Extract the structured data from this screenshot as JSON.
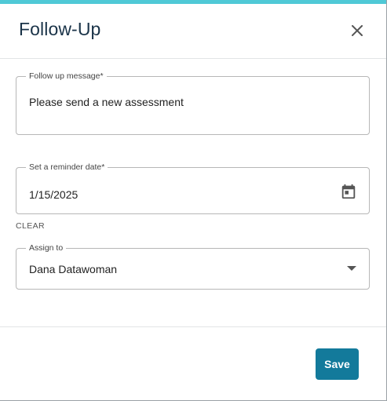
{
  "dialog": {
    "title": "Follow-Up",
    "close_icon": "close-icon"
  },
  "form": {
    "message": {
      "label": "Follow up message*",
      "value": "Please send a new assessment"
    },
    "reminder_date": {
      "label": "Set a reminder date*",
      "value": "1/15/2025",
      "icon": "calendar-icon",
      "clear_label": "CLEAR"
    },
    "assign_to": {
      "label": "Assign to",
      "value": "Dana Datawoman",
      "icon": "chevron-down-icon"
    }
  },
  "footer": {
    "save_label": "Save"
  },
  "colors": {
    "accent_bar": "#4fc9d6",
    "title_text": "#1a3348",
    "primary_button": "#137a9b"
  }
}
